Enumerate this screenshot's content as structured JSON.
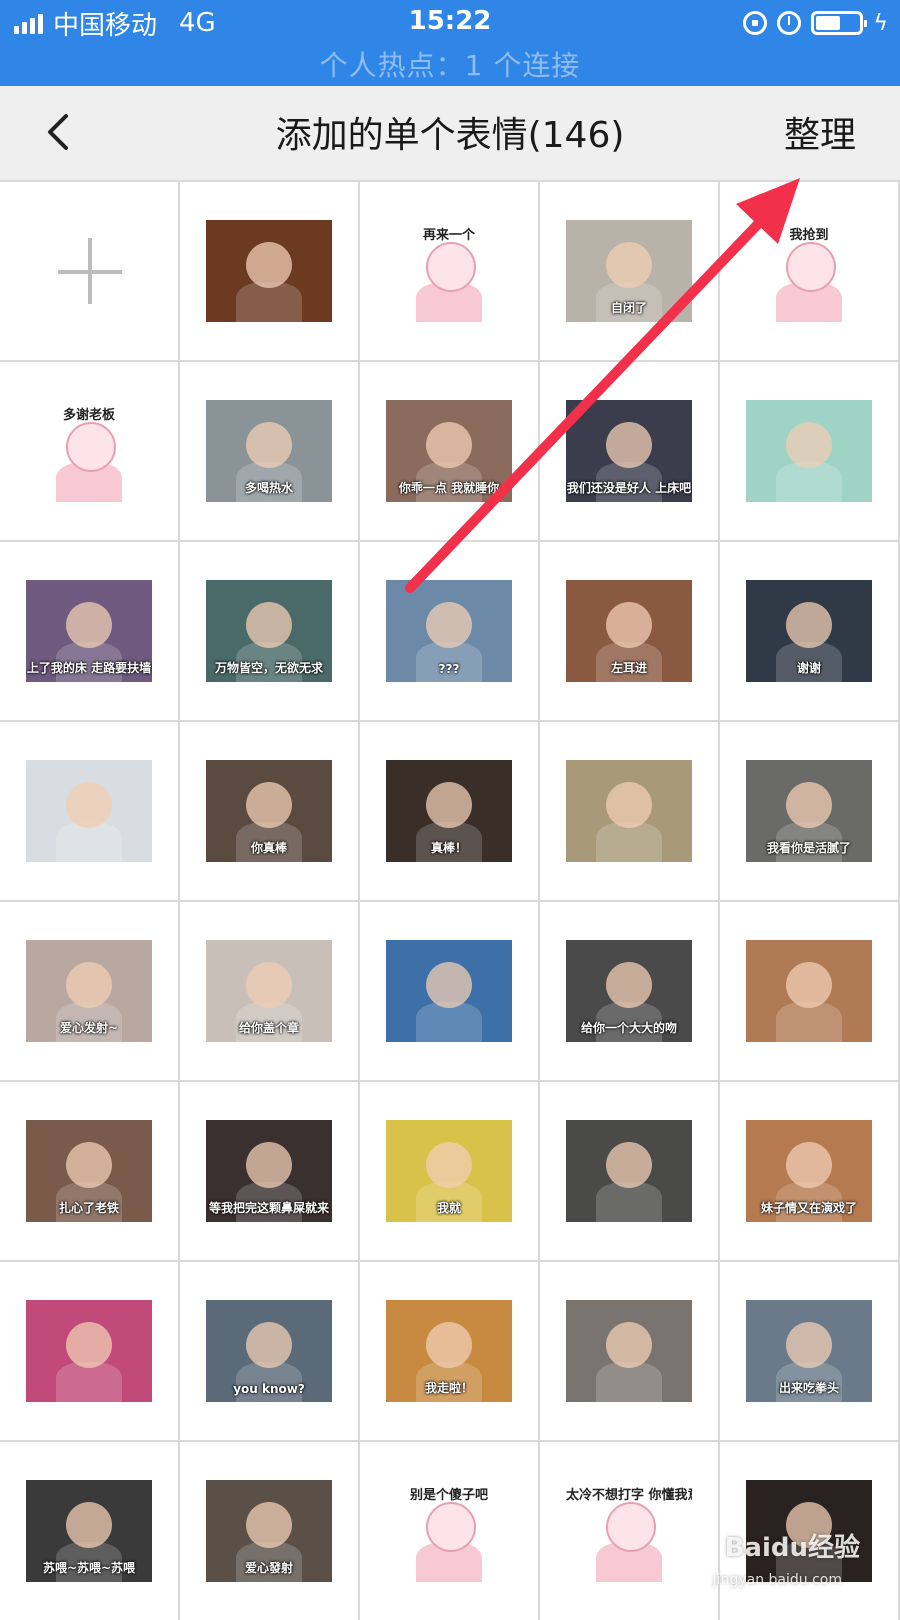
{
  "status_bar": {
    "carrier": "中国移动",
    "network": "4G",
    "time": "15:22",
    "hotspot_text": "个人热点：1 个连接",
    "icons": [
      "signal-icon",
      "rotation-lock-icon",
      "alarm-icon",
      "battery-icon",
      "charging-icon"
    ]
  },
  "header": {
    "back_icon": "chevron-left-icon",
    "title": "添加的单个表情(146)",
    "action_label": "整理"
  },
  "grid": {
    "add_icon": "plus-icon",
    "stickers": [
      {
        "caption": "",
        "bg": "#6b3a20"
      },
      {
        "caption": "再来一个",
        "bg": "#ffffff"
      },
      {
        "caption": "自闭了",
        "bg": "#b9b2a8"
      },
      {
        "caption": "我抢到",
        "bg": "#ffffff"
      },
      {
        "caption": "多谢老板",
        "bg": "#ffffff"
      },
      {
        "caption": "多喝热水",
        "bg": "#8a9498"
      },
      {
        "caption": "你乖一点 我就睡你",
        "bg": "#8b6b5c"
      },
      {
        "caption": "我们还没是好人 上床吧",
        "bg": "#3b3c4c"
      },
      {
        "caption": "",
        "bg": "#9fd3c6"
      },
      {
        "caption": "上了我的床 走路要扶墙",
        "bg": "#6d5a7e"
      },
      {
        "caption": "万物皆空，无欲无求",
        "bg": "#4a6a6a"
      },
      {
        "caption": "???",
        "bg": "#6c8aa8"
      },
      {
        "caption": "左耳进",
        "bg": "#8a5a40"
      },
      {
        "caption": "谢谢",
        "bg": "#2f3a46"
      },
      {
        "caption": "",
        "bg": "#d7dde0"
      },
      {
        "caption": "你真棒",
        "bg": "#5b4a40"
      },
      {
        "caption": "真棒！",
        "bg": "#3a2e28"
      },
      {
        "caption": "",
        "bg": "#a89a78"
      },
      {
        "caption": "我看你是活腻了",
        "bg": "#6a6a68"
      },
      {
        "caption": "爱心发射~",
        "bg": "#b8a8a0"
      },
      {
        "caption": "给你盖个章",
        "bg": "#c8c0b8"
      },
      {
        "caption": "",
        "bg": "#3d6fa8"
      },
      {
        "caption": "给你一个大大的吻",
        "bg": "#4a4a4a"
      },
      {
        "caption": "",
        "bg": "#b07a55"
      },
      {
        "caption": "扎心了老铁",
        "bg": "#7a5a4a"
      },
      {
        "caption": "等我把完这颗鼻屎就来",
        "bg": "#3a3030"
      },
      {
        "caption": "我就",
        "bg": "#d9c24a"
      },
      {
        "caption": "",
        "bg": "#4a4a48"
      },
      {
        "caption": "妹子情又在演戏了",
        "bg": "#b57a50"
      },
      {
        "caption": "",
        "bg": "#c24a7a"
      },
      {
        "caption": "you know?",
        "bg": "#5a6a78"
      },
      {
        "caption": "我走啦！",
        "bg": "#c88a40"
      },
      {
        "caption": "",
        "bg": "#7a7470"
      },
      {
        "caption": "出来吃拳头",
        "bg": "#6a7a8a"
      },
      {
        "caption": "苏喂~苏喂~苏喂",
        "bg": "#3a3a3a"
      },
      {
        "caption": "爱心發射",
        "bg": "#5a5048"
      },
      {
        "caption": "别是个傻子吧",
        "bg": "#ffffff"
      },
      {
        "caption": "太冷不想打字 你懂我意思吧",
        "bg": "#ffffff"
      },
      {
        "caption": "",
        "bg": "#2a2220"
      }
    ]
  },
  "watermark": {
    "brand": "Baidu经验",
    "url": "jingyan.baidu.com"
  },
  "colors": {
    "status_bar": "#2f86e6",
    "arrow": "#f2304a",
    "header_bg": "#efefef"
  }
}
